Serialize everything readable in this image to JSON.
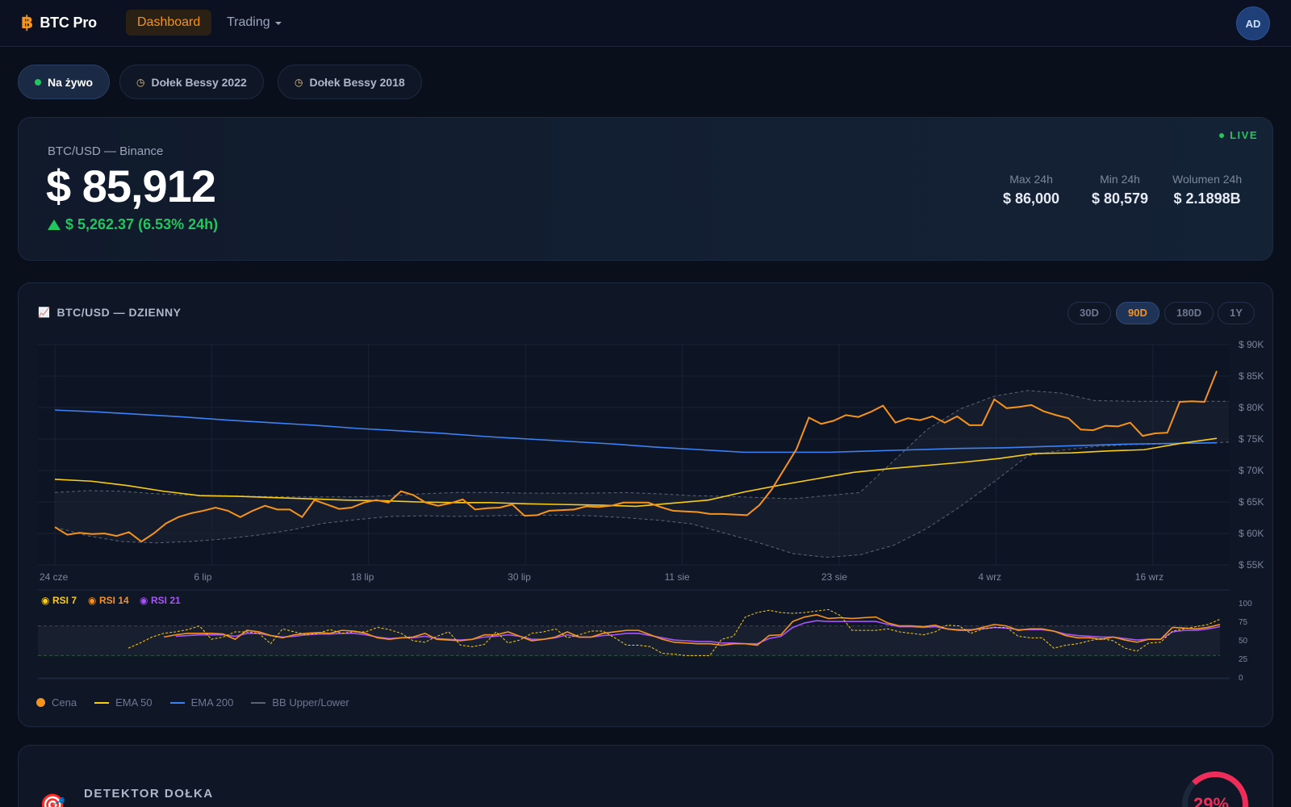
{
  "header": {
    "brand_icon": "bitcoin-icon",
    "brand_symbol": "฿",
    "brand_name": "BTC Pro",
    "nav": {
      "dashboard": "Dashboard",
      "trading": "Trading"
    },
    "avatar_initials": "AD"
  },
  "modes": [
    {
      "label": "Na żywo",
      "icon": "live-dot-icon",
      "active": true
    },
    {
      "label": "Dołek Bessy 2022",
      "icon": "clock-icon",
      "active": false
    },
    {
      "label": "Dołek Bessy 2018",
      "icon": "clock-icon",
      "active": false
    }
  ],
  "price": {
    "pair": "BTC/USD — Binance",
    "value": "$ 85,912",
    "change": "$ 5,262.37 (6.53% 24h)",
    "live_label": "LIVE",
    "stats": [
      {
        "label": "Max 24h",
        "value": "$ 86,000"
      },
      {
        "label": "Min 24h",
        "value": "$ 80,579"
      },
      {
        "label": "Wolumen 24h",
        "value": "$ 2.1898B"
      }
    ]
  },
  "chart_card": {
    "title": "BTC/USD — DZIENNY",
    "title_icon": "chart-icon",
    "ranges": [
      "30D",
      "90D",
      "180D",
      "1Y"
    ],
    "active_range": "90D",
    "legend": [
      {
        "label": "Cena",
        "color": "#f7931a"
      },
      {
        "label": "EMA 50",
        "color": "#facc15"
      },
      {
        "label": "EMA 200",
        "color": "#3b82f6"
      },
      {
        "label": "BB Upper/Lower",
        "color": "#5b6476"
      }
    ],
    "rsi_toggles": [
      {
        "label": "RSI 7",
        "color": "#facc15"
      },
      {
        "label": "RSI 14",
        "color": "#f7931a"
      },
      {
        "label": "RSI 21",
        "color": "#a855f7"
      }
    ]
  },
  "chart_data": {
    "type": "line",
    "xlabels": [
      "24 cze",
      "6 lip",
      "18 lip",
      "30 lip",
      "11 sie",
      "23 sie",
      "4 wrz",
      "16 wrz"
    ],
    "yticks": [
      "$ 90K",
      "$ 85K",
      "$ 80K",
      "$ 75K",
      "$ 70K",
      "$ 65K",
      "$ 60K",
      "$ 55K"
    ],
    "ylim": [
      55000,
      90000
    ],
    "rsi_ticks": [
      "100",
      "75",
      "50",
      "25",
      "0"
    ],
    "rsi_lim": [
      0,
      100
    ],
    "series": [
      {
        "name": "Cena",
        "color": "#f7931a",
        "values": [
          61000,
          59800,
          60100,
          59900,
          60000,
          59600,
          60200,
          58700,
          60000,
          61600,
          62600,
          63200,
          63600,
          64100,
          63600,
          62600,
          63600,
          64400,
          63800,
          63800,
          62600,
          65300,
          64600,
          63900,
          64100,
          64900,
          65300,
          64900,
          66700,
          66100,
          64900,
          64400,
          64800,
          65400,
          63800,
          64000,
          64100,
          64600,
          62800,
          62900,
          63600,
          63700,
          63800,
          64300,
          64200,
          64400,
          64900,
          64900,
          64900,
          64200,
          63600,
          63500,
          63400,
          63100,
          63100,
          63000,
          62900,
          64500,
          67000,
          70200,
          73400,
          78400,
          77400,
          77900,
          78800,
          78500,
          79300,
          80300,
          77600,
          78300,
          78000,
          78600,
          77600,
          78600,
          77200,
          77200,
          81300,
          79900,
          80100,
          80400,
          79400,
          78800,
          78300,
          76500,
          76400,
          77100,
          77000,
          77600,
          75500,
          75900,
          76000,
          80900,
          81000,
          80900,
          85800
        ]
      },
      {
        "name": "EMA 50",
        "color": "#facc15",
        "values": [
          68600,
          68300,
          67600,
          66700,
          66000,
          65900,
          65700,
          65500,
          65300,
          65200,
          65000,
          64900,
          64900,
          64700,
          64600,
          64500,
          64300,
          64800,
          65300,
          66600,
          67700,
          68700,
          69700,
          70300,
          70800,
          71300,
          71900,
          72700,
          72800,
          73100,
          73300,
          74300,
          75100
        ]
      },
      {
        "name": "EMA 200",
        "color": "#3b82f6",
        "values": [
          79600,
          79300,
          78900,
          78500,
          78000,
          77600,
          77200,
          76700,
          76300,
          75900,
          75400,
          75000,
          74600,
          74200,
          73700,
          73300,
          72900,
          72900,
          72900,
          73100,
          73300,
          73500,
          73600,
          73800,
          74000,
          74200,
          74300,
          74400
        ]
      },
      {
        "name": "BB Upper",
        "color": "#5b6476",
        "values": [
          66500,
          66800,
          66700,
          66300,
          66100,
          66000,
          65900,
          65800,
          65800,
          65800,
          66000,
          66300,
          66500,
          66500,
          66400,
          66400,
          66400,
          66500,
          66300,
          66000,
          65900,
          65700,
          65500,
          66000,
          66500,
          71500,
          76500,
          79800,
          81800,
          82700,
          82300,
          81100,
          81000,
          81000,
          81000,
          81000
        ]
      },
      {
        "name": "BB Lower",
        "color": "#5b6476",
        "values": [
          61000,
          59600,
          58700,
          58500,
          58700,
          59100,
          59700,
          60500,
          61600,
          62200,
          62700,
          62800,
          62700,
          62800,
          62900,
          62900,
          62800,
          62500,
          62100,
          61500,
          60000,
          58500,
          56800,
          56200,
          56600,
          58100,
          60800,
          64300,
          68200,
          72300,
          73200,
          73800,
          74100,
          74200,
          74300,
          74500
        ]
      }
    ],
    "rsi": [
      {
        "name": "RSI 7",
        "color": "#facc15",
        "values": [
          40,
          47,
          55,
          60,
          62,
          65,
          70,
          52,
          55,
          62,
          62,
          60,
          46,
          66,
          62,
          58,
          60,
          65,
          60,
          62,
          62,
          68,
          65,
          60,
          50,
          48,
          56,
          62,
          44,
          42,
          45,
          62,
          47,
          51,
          60,
          62,
          66,
          54,
          58,
          63,
          63,
          54,
          44,
          44,
          42,
          33,
          32,
          30,
          30,
          30,
          52,
          56,
          82,
          88,
          91,
          88,
          87,
          88,
          90,
          92,
          84,
          64,
          64,
          64,
          66,
          62,
          60,
          58,
          62,
          71,
          70,
          60,
          66,
          68,
          68,
          56,
          54,
          54,
          40,
          44,
          46,
          50,
          53,
          50,
          40,
          36,
          47,
          48,
          63,
          66,
          69,
          72,
          79
        ]
      },
      {
        "name": "RSI 14",
        "color": "#f7931a",
        "values": [
          null,
          null,
          null,
          55,
          58,
          60,
          60,
          60,
          59,
          52,
          64,
          62,
          57,
          54,
          58,
          60,
          61,
          60,
          64,
          63,
          60,
          54,
          52,
          54,
          55,
          60,
          52,
          51,
          50,
          52,
          58,
          58,
          62,
          56,
          50,
          52,
          55,
          62,
          55,
          55,
          60,
          62,
          64,
          64,
          58,
          52,
          48,
          47,
          46,
          46,
          44,
          46,
          46,
          44,
          57,
          58,
          76,
          82,
          85,
          80,
          81,
          80,
          81,
          82,
          74,
          70,
          70,
          69,
          71,
          66,
          64,
          64,
          68,
          72,
          70,
          64,
          66,
          66,
          63,
          57,
          54,
          54,
          52,
          55,
          51,
          48,
          52,
          52,
          68,
          67,
          66,
          68,
          72
        ]
      },
      {
        "name": "RSI 21",
        "color": "#a855f7",
        "values": [
          null,
          null,
          null,
          null,
          56,
          57,
          58,
          58,
          58,
          56,
          60,
          60,
          57,
          55,
          56,
          58,
          59,
          59,
          60,
          60,
          58,
          55,
          53,
          54,
          54,
          56,
          53,
          52,
          51,
          52,
          55,
          56,
          58,
          56,
          52,
          52,
          54,
          58,
          55,
          55,
          57,
          58,
          60,
          60,
          57,
          54,
          51,
          50,
          49,
          49,
          47,
          47,
          46,
          46,
          53,
          56,
          68,
          74,
          77,
          76,
          76,
          76,
          76,
          76,
          72,
          69,
          69,
          68,
          69,
          66,
          65,
          65,
          66,
          68,
          67,
          65,
          65,
          65,
          63,
          59,
          57,
          56,
          55,
          55,
          53,
          51,
          52,
          52,
          62,
          64,
          64,
          66,
          69
        ]
      }
    ]
  },
  "detector": {
    "icon": "target-icon",
    "title": "DETEKTOR DOŁKA",
    "percent": "29%"
  }
}
